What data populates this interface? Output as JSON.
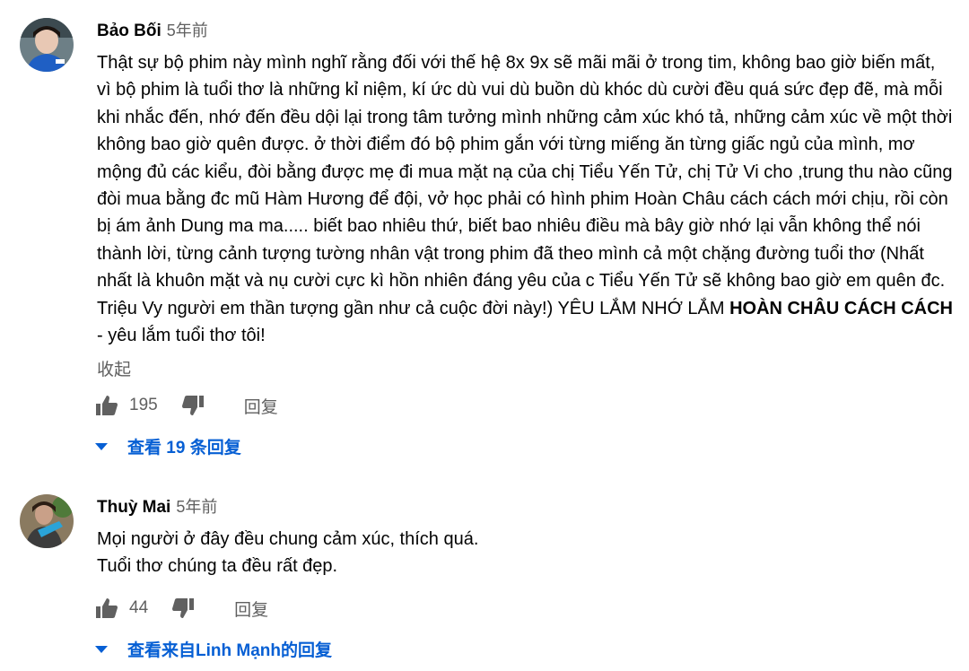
{
  "comments": [
    {
      "author": "Bảo Bối",
      "time": "5年前",
      "text_before_bold": "Thật sự bộ phim này mình nghĩ rằng đối với thế hệ 8x 9x sẽ mãi mãi ở trong tim, không bao giờ biến mất, vì bộ phim là tuổi thơ là những kỉ niệm, kí ức dù vui dù buồn dù khóc dù cười đều quá sức đẹp đẽ, mà mỗi khi nhắc đến, nhớ đến đều dội lại trong tâm tưởng mình những cảm xúc khó tả, những cảm xúc về một thời không bao giờ quên được. ở thời điểm đó bộ phim gắn với từng miếng ăn từng giấc ngủ của mình, mơ mộng đủ các kiểu, đòi bằng được mẹ đi mua mặt nạ của chị Tiểu Yến Tử, chị Tử Vi cho ,trung thu nào cũng đòi mua bằng đc mũ Hàm Hương để đội, vở học phải có hình phim Hoàn Châu cách cách mới chịu, rồi còn bị ám ảnh Dung ma ma..... biết bao nhiêu thứ, biết bao nhiêu điều mà bây giờ nhớ lại vẫn không thể nói thành lời, từng cảnh tượng tường nhân vật trong phim đã theo mình cả một chặng đường tuổi thơ (Nhất nhất là khuôn mặt và nụ cười cực kì hồn nhiên đáng yêu của c Tiểu Yến Tử sẽ không bao giờ em quên đc. Triệu Vy người em thần tượng gần như cả cuộc đời này!) YÊU LẮM NHỚ LẮM ",
      "text_bold": "HOÀN CHÂU CÁCH CÁCH",
      "text_after_bold": " - yêu lắm tuổi thơ tôi!",
      "collapse_label": "收起",
      "likes": "195",
      "reply_label": "回复",
      "view_replies_label": "查看 19 条回复"
    },
    {
      "author": "Thuỳ Mai",
      "time": "5年前",
      "line1": "Mọi người ở đây đều chung cảm xúc, thích quá.",
      "line2": "Tuổi thơ chúng ta đều rất đẹp.",
      "likes": "44",
      "reply_label": "回复",
      "view_replies_label": "查看来自Linh Mạnh的回复"
    }
  ],
  "colors": {
    "link": "#065fd4",
    "secondary": "#606060",
    "text": "#030303"
  }
}
